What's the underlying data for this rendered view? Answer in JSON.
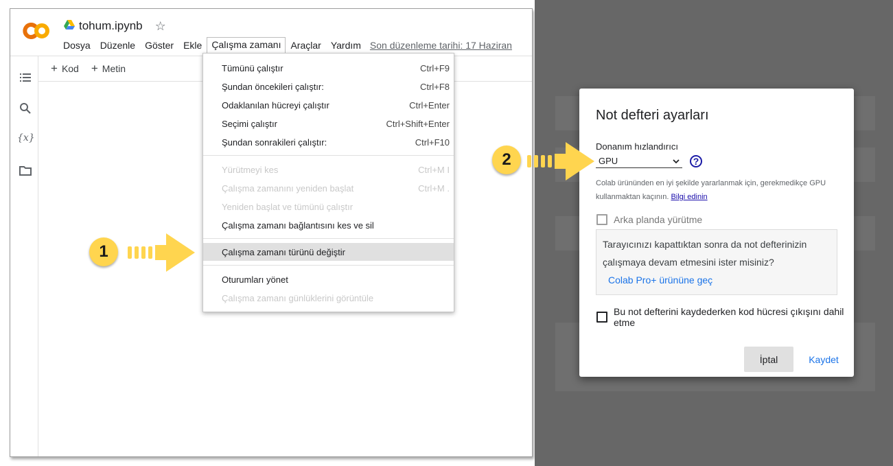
{
  "colab": {
    "file_name": "tohum.ipynb",
    "menu": [
      "Dosya",
      "Düzenle",
      "Göster",
      "Ekle",
      "Çalışma zamanı",
      "Araçlar",
      "Yardım"
    ],
    "last_edit": "Son düzenleme tarihi: 17 Haziran",
    "toolbar": {
      "code": "Kod",
      "text": "Metin"
    },
    "sidebar_icons": [
      "table-of-contents-icon",
      "search-icon",
      "variables-icon",
      "files-icon"
    ],
    "variables_icon_glyph": "{x}",
    "runtime_menu": [
      {
        "label": "Tümünü çalıştır",
        "shortcut": "Ctrl+F9",
        "disabled": false
      },
      {
        "label": "Şundan öncekileri çalıştır:",
        "shortcut": "Ctrl+F8",
        "disabled": false
      },
      {
        "label": "Odaklanılan hücreyi çalıştır",
        "shortcut": "Ctrl+Enter",
        "disabled": false
      },
      {
        "label": "Seçimi çalıştır",
        "shortcut": "Ctrl+Shift+Enter",
        "disabled": false
      },
      {
        "label": "Şundan sonrakileri çalıştır:",
        "shortcut": "Ctrl+F10",
        "disabled": false
      },
      {
        "label": "Yürütmeyi kes",
        "shortcut": "Ctrl+M I",
        "disabled": true
      },
      {
        "label": "Çalışma zamanını yeniden başlat",
        "shortcut": "Ctrl+M .",
        "disabled": true
      },
      {
        "label": "Yeniden başlat ve tümünü çalıştır",
        "shortcut": "",
        "disabled": true
      },
      {
        "label": "Çalışma zamanı bağlantısını kes ve sil",
        "shortcut": "",
        "disabled": false
      },
      {
        "label": "Çalışma zamanı türünü değiştir",
        "shortcut": "",
        "disabled": false,
        "highlighted": true
      },
      {
        "label": "Oturumları yönet",
        "shortcut": "",
        "disabled": false
      },
      {
        "label": "Çalışma zamanı günlüklerini görüntüle",
        "shortcut": "",
        "disabled": true
      }
    ]
  },
  "callouts": {
    "one": "1",
    "two": "2"
  },
  "dialog": {
    "title": "Not defteri ayarları",
    "hw_label": "Donanım hızlandırıcı",
    "hw_value": "GPU",
    "help_glyph": "?",
    "hw_note": "Colab ürününden en iyi şekilde yararlanmak için, gerekmedikçe GPU kullanmaktan kaçının.",
    "hw_note_link": "Bilgi edinin",
    "background_exec": "Arka planda yürütme",
    "pro_text": "Tarayıcınızı kapattıktan sonra da not defterinizin çalışmaya devam etmesini ister misiniz?",
    "pro_link": "Colab Pro+ ürününe geç",
    "omit_output": "Bu not defterini kaydederken kod hücresi çıkışını dahil etme",
    "cancel": "İptal",
    "save": "Kaydet"
  },
  "colors": {
    "accent_blue": "#1a73e8",
    "callout_yellow": "#ffd54f",
    "backdrop": "#676767",
    "logo_orange": "#f9ab00"
  }
}
